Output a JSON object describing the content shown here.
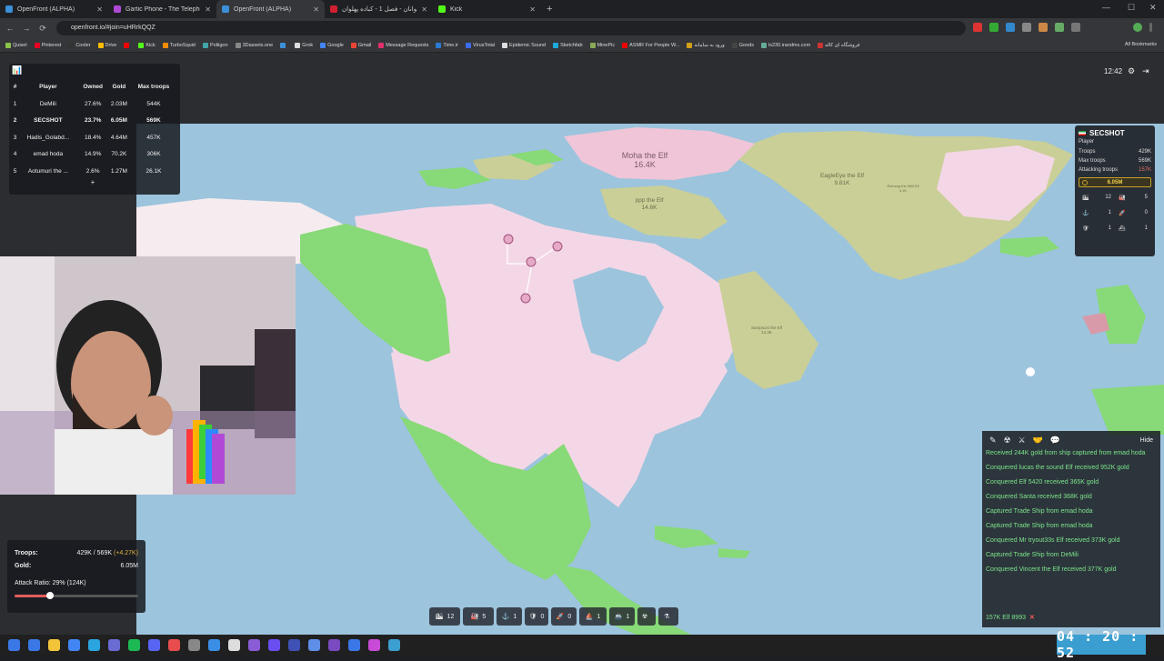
{
  "browser": {
    "tabs": [
      {
        "label": "OpenFront (ALPHA)",
        "color": "#3c8fd9"
      },
      {
        "label": "Gartic Phone - The Telephone G",
        "color": "#b04ad6"
      },
      {
        "label": "OpenFront (ALPHA)",
        "color": "#3c8fd9"
      },
      {
        "label": "پهلوانان - فصل 1 - کباده پهلوان",
        "color": "#d02030"
      },
      {
        "label": "Kick",
        "color": "#53fc18"
      }
    ],
    "url": "openfront.io/#join=uHRrkQQZ",
    "bookmarks": [
      {
        "label": "Quisel",
        "color": "#8bc34a"
      },
      {
        "label": "Pinterest",
        "color": "#e60023"
      },
      {
        "label": "Cooler",
        "color": "#333"
      },
      {
        "label": "Drive",
        "color": "#fbbc04"
      },
      {
        "label": "",
        "color": "#e00"
      },
      {
        "label": "Kick",
        "color": "#53fc18"
      },
      {
        "label": "TurboSquid",
        "color": "#f28d00"
      },
      {
        "label": "Poliigon",
        "color": "#3fa7a7"
      },
      {
        "label": "3Dassets.one",
        "color": "#888"
      },
      {
        "label": "",
        "color": "#3c8fd9"
      },
      {
        "label": "Grok",
        "color": "#ddd"
      },
      {
        "label": "Google",
        "color": "#4285f4"
      },
      {
        "label": "Gmail",
        "color": "#ea4335"
      },
      {
        "label": "Message Requests",
        "color": "#e1306c"
      },
      {
        "label": "Time.ir",
        "color": "#2a7bd1"
      },
      {
        "label": "VirusTotal",
        "color": "#3c6df0"
      },
      {
        "label": "Epidemic Sound",
        "color": "#ddd"
      },
      {
        "label": "Sketchfab",
        "color": "#1caad9"
      },
      {
        "label": "MinePic",
        "color": "#8a5"
      },
      {
        "label": "ASMR For People W...",
        "color": "#e00"
      },
      {
        "label": "ورود به سامانه",
        "color": "#d4a017"
      },
      {
        "label": "Goods",
        "color": "#444"
      },
      {
        "label": "ls230.irandms.com",
        "color": "#6a9"
      },
      {
        "label": "فروشگاه ای کاله",
        "color": "#c33"
      }
    ],
    "all_bookmarks": "All Bookmarks",
    "nav": {
      "back": "←",
      "forward": "→",
      "reload": "⟳"
    },
    "window_controls": {
      "minimize": "—",
      "maximize": "☐",
      "close": "✕"
    }
  },
  "leaderboard": {
    "icon": "📊",
    "headers": [
      "#",
      "Player",
      "Owned",
      "Gold",
      "Max troops"
    ],
    "rows": [
      {
        "rank": "1",
        "player": "DeMili",
        "owned": "27.6%",
        "gold": "2.03M",
        "troops": "544K"
      },
      {
        "rank": "2",
        "player": "SECSHOT",
        "owned": "23.7%",
        "gold": "6.05M",
        "troops": "569K"
      },
      {
        "rank": "3",
        "player": "Hadis_Golabd...",
        "owned": "18.4%",
        "gold": "4.64M",
        "troops": "457K"
      },
      {
        "rank": "4",
        "player": "emad hoda",
        "owned": "14.9%",
        "gold": "70.2K",
        "troops": "306K"
      },
      {
        "rank": "5",
        "player": "Aotumuri the ...",
        "owned": "2.6%",
        "gold": "1.27M",
        "troops": "26.1K"
      }
    ],
    "expand": "+"
  },
  "topright": {
    "time": "12:42",
    "gear": "⚙",
    "exit": "⇥"
  },
  "player_panel": {
    "name": "SECSHOT",
    "type": "Player",
    "rows": [
      {
        "label": "Troops",
        "value": "429K"
      },
      {
        "label": "Max troops",
        "value": "569K"
      },
      {
        "label": "Attacking troops",
        "value": "157K"
      }
    ],
    "gold": "6.05M",
    "buildings": [
      {
        "icon": "🏙",
        "value": "12"
      },
      {
        "icon": "🏭",
        "value": "5"
      },
      {
        "icon": "⚓",
        "value": "1"
      },
      {
        "icon": "🚀",
        "value": "0"
      },
      {
        "icon": "🛡",
        "value": "1"
      },
      {
        "icon": "⛴",
        "value": "1"
      }
    ]
  },
  "map_labels": [
    {
      "name": "Moha the Elf",
      "troops": "16.4K"
    },
    {
      "name": "EagleEye the Elf",
      "troops": "9.81K"
    },
    {
      "name": "ppp the Elf",
      "troops": "14.6K"
    },
    {
      "name": "Reincog the Milli Elf",
      "troops": "4.1K"
    },
    {
      "name": "Sampsoni the Elf",
      "troops": "14.3K"
    }
  ],
  "stats": {
    "troops_label": "Troops:",
    "troops_value": "429K / 569K",
    "troops_inc": "(+4.27K)",
    "gold_label": "Gold:",
    "gold_value": "6.05M",
    "attack_ratio": "Attack Ratio: 29% (124K)",
    "attack_ratio_value": 0.29
  },
  "events": {
    "hide": "Hide",
    "icons": [
      "✎",
      "☢",
      "⚔",
      "🤝",
      "💬"
    ],
    "lines": [
      "Received 244K gold from ship captured from emad hoda",
      "Conquered lucas the sound Elf received 952K gold",
      "Conquered Elf 5420 received 365K gold",
      "Conquered Santa received 368K gold",
      "Captured Trade Ship from emad hoda",
      "Captured Trade Ship from emad hoda",
      "Conquered Mr tryout33s Elf received 373K gold",
      "Captured Trade Ship from DeMili",
      "Conquered Vincent the Elf received 377K gold"
    ],
    "attack_label": "157K Elf 8993",
    "cancel": "✕"
  },
  "build_bar": [
    {
      "icon": "🏙",
      "value": "12"
    },
    {
      "icon": "🏭",
      "value": "5"
    },
    {
      "icon": "⚓",
      "value": "1"
    },
    {
      "icon": "🛡",
      "value": "0"
    },
    {
      "icon": "🚀",
      "value": "0"
    },
    {
      "icon": "⛵",
      "value": "1"
    },
    {
      "icon": "🚢",
      "value": "1"
    },
    {
      "icon": "☢",
      "value": ""
    },
    {
      "icon": "⚗",
      "value": ""
    }
  ],
  "stream_timer": "04 : 20 : 52",
  "colors": {
    "ocean": "#9cc4dd",
    "player_territory": "#f4d7e6",
    "bot_green": "#88d977",
    "elf_olive": "#c9cf97",
    "accent_red": "#e35d5d"
  }
}
